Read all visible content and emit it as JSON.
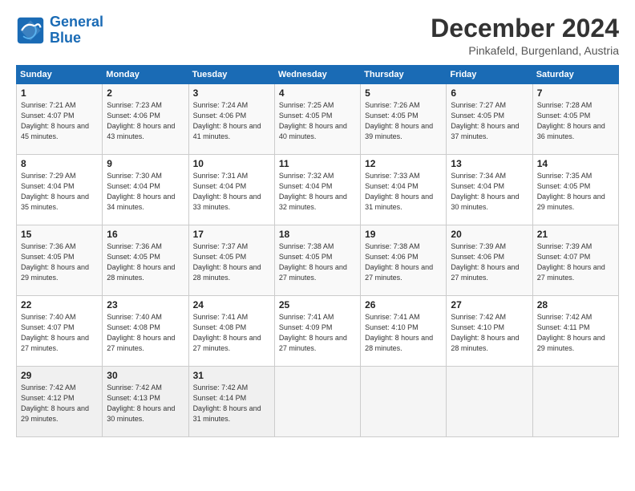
{
  "header": {
    "logo_line1": "General",
    "logo_line2": "Blue",
    "title": "December 2024",
    "subtitle": "Pinkafeld, Burgenland, Austria"
  },
  "weekdays": [
    "Sunday",
    "Monday",
    "Tuesday",
    "Wednesday",
    "Thursday",
    "Friday",
    "Saturday"
  ],
  "weeks": [
    [
      {
        "day": "1",
        "sunrise": "Sunrise: 7:21 AM",
        "sunset": "Sunset: 4:07 PM",
        "daylight": "Daylight: 8 hours and 45 minutes."
      },
      {
        "day": "2",
        "sunrise": "Sunrise: 7:23 AM",
        "sunset": "Sunset: 4:06 PM",
        "daylight": "Daylight: 8 hours and 43 minutes."
      },
      {
        "day": "3",
        "sunrise": "Sunrise: 7:24 AM",
        "sunset": "Sunset: 4:06 PM",
        "daylight": "Daylight: 8 hours and 41 minutes."
      },
      {
        "day": "4",
        "sunrise": "Sunrise: 7:25 AM",
        "sunset": "Sunset: 4:05 PM",
        "daylight": "Daylight: 8 hours and 40 minutes."
      },
      {
        "day": "5",
        "sunrise": "Sunrise: 7:26 AM",
        "sunset": "Sunset: 4:05 PM",
        "daylight": "Daylight: 8 hours and 39 minutes."
      },
      {
        "day": "6",
        "sunrise": "Sunrise: 7:27 AM",
        "sunset": "Sunset: 4:05 PM",
        "daylight": "Daylight: 8 hours and 37 minutes."
      },
      {
        "day": "7",
        "sunrise": "Sunrise: 7:28 AM",
        "sunset": "Sunset: 4:05 PM",
        "daylight": "Daylight: 8 hours and 36 minutes."
      }
    ],
    [
      {
        "day": "8",
        "sunrise": "Sunrise: 7:29 AM",
        "sunset": "Sunset: 4:04 PM",
        "daylight": "Daylight: 8 hours and 35 minutes."
      },
      {
        "day": "9",
        "sunrise": "Sunrise: 7:30 AM",
        "sunset": "Sunset: 4:04 PM",
        "daylight": "Daylight: 8 hours and 34 minutes."
      },
      {
        "day": "10",
        "sunrise": "Sunrise: 7:31 AM",
        "sunset": "Sunset: 4:04 PM",
        "daylight": "Daylight: 8 hours and 33 minutes."
      },
      {
        "day": "11",
        "sunrise": "Sunrise: 7:32 AM",
        "sunset": "Sunset: 4:04 PM",
        "daylight": "Daylight: 8 hours and 32 minutes."
      },
      {
        "day": "12",
        "sunrise": "Sunrise: 7:33 AM",
        "sunset": "Sunset: 4:04 PM",
        "daylight": "Daylight: 8 hours and 31 minutes."
      },
      {
        "day": "13",
        "sunrise": "Sunrise: 7:34 AM",
        "sunset": "Sunset: 4:04 PM",
        "daylight": "Daylight: 8 hours and 30 minutes."
      },
      {
        "day": "14",
        "sunrise": "Sunrise: 7:35 AM",
        "sunset": "Sunset: 4:05 PM",
        "daylight": "Daylight: 8 hours and 29 minutes."
      }
    ],
    [
      {
        "day": "15",
        "sunrise": "Sunrise: 7:36 AM",
        "sunset": "Sunset: 4:05 PM",
        "daylight": "Daylight: 8 hours and 29 minutes."
      },
      {
        "day": "16",
        "sunrise": "Sunrise: 7:36 AM",
        "sunset": "Sunset: 4:05 PM",
        "daylight": "Daylight: 8 hours and 28 minutes."
      },
      {
        "day": "17",
        "sunrise": "Sunrise: 7:37 AM",
        "sunset": "Sunset: 4:05 PM",
        "daylight": "Daylight: 8 hours and 28 minutes."
      },
      {
        "day": "18",
        "sunrise": "Sunrise: 7:38 AM",
        "sunset": "Sunset: 4:05 PM",
        "daylight": "Daylight: 8 hours and 27 minutes."
      },
      {
        "day": "19",
        "sunrise": "Sunrise: 7:38 AM",
        "sunset": "Sunset: 4:06 PM",
        "daylight": "Daylight: 8 hours and 27 minutes."
      },
      {
        "day": "20",
        "sunrise": "Sunrise: 7:39 AM",
        "sunset": "Sunset: 4:06 PM",
        "daylight": "Daylight: 8 hours and 27 minutes."
      },
      {
        "day": "21",
        "sunrise": "Sunrise: 7:39 AM",
        "sunset": "Sunset: 4:07 PM",
        "daylight": "Daylight: 8 hours and 27 minutes."
      }
    ],
    [
      {
        "day": "22",
        "sunrise": "Sunrise: 7:40 AM",
        "sunset": "Sunset: 4:07 PM",
        "daylight": "Daylight: 8 hours and 27 minutes."
      },
      {
        "day": "23",
        "sunrise": "Sunrise: 7:40 AM",
        "sunset": "Sunset: 4:08 PM",
        "daylight": "Daylight: 8 hours and 27 minutes."
      },
      {
        "day": "24",
        "sunrise": "Sunrise: 7:41 AM",
        "sunset": "Sunset: 4:08 PM",
        "daylight": "Daylight: 8 hours and 27 minutes."
      },
      {
        "day": "25",
        "sunrise": "Sunrise: 7:41 AM",
        "sunset": "Sunset: 4:09 PM",
        "daylight": "Daylight: 8 hours and 27 minutes."
      },
      {
        "day": "26",
        "sunrise": "Sunrise: 7:41 AM",
        "sunset": "Sunset: 4:10 PM",
        "daylight": "Daylight: 8 hours and 28 minutes."
      },
      {
        "day": "27",
        "sunrise": "Sunrise: 7:42 AM",
        "sunset": "Sunset: 4:10 PM",
        "daylight": "Daylight: 8 hours and 28 minutes."
      },
      {
        "day": "28",
        "sunrise": "Sunrise: 7:42 AM",
        "sunset": "Sunset: 4:11 PM",
        "daylight": "Daylight: 8 hours and 29 minutes."
      }
    ],
    [
      {
        "day": "29",
        "sunrise": "Sunrise: 7:42 AM",
        "sunset": "Sunset: 4:12 PM",
        "daylight": "Daylight: 8 hours and 29 minutes."
      },
      {
        "day": "30",
        "sunrise": "Sunrise: 7:42 AM",
        "sunset": "Sunset: 4:13 PM",
        "daylight": "Daylight: 8 hours and 30 minutes."
      },
      {
        "day": "31",
        "sunrise": "Sunrise: 7:42 AM",
        "sunset": "Sunset: 4:14 PM",
        "daylight": "Daylight: 8 hours and 31 minutes."
      },
      null,
      null,
      null,
      null
    ]
  ]
}
